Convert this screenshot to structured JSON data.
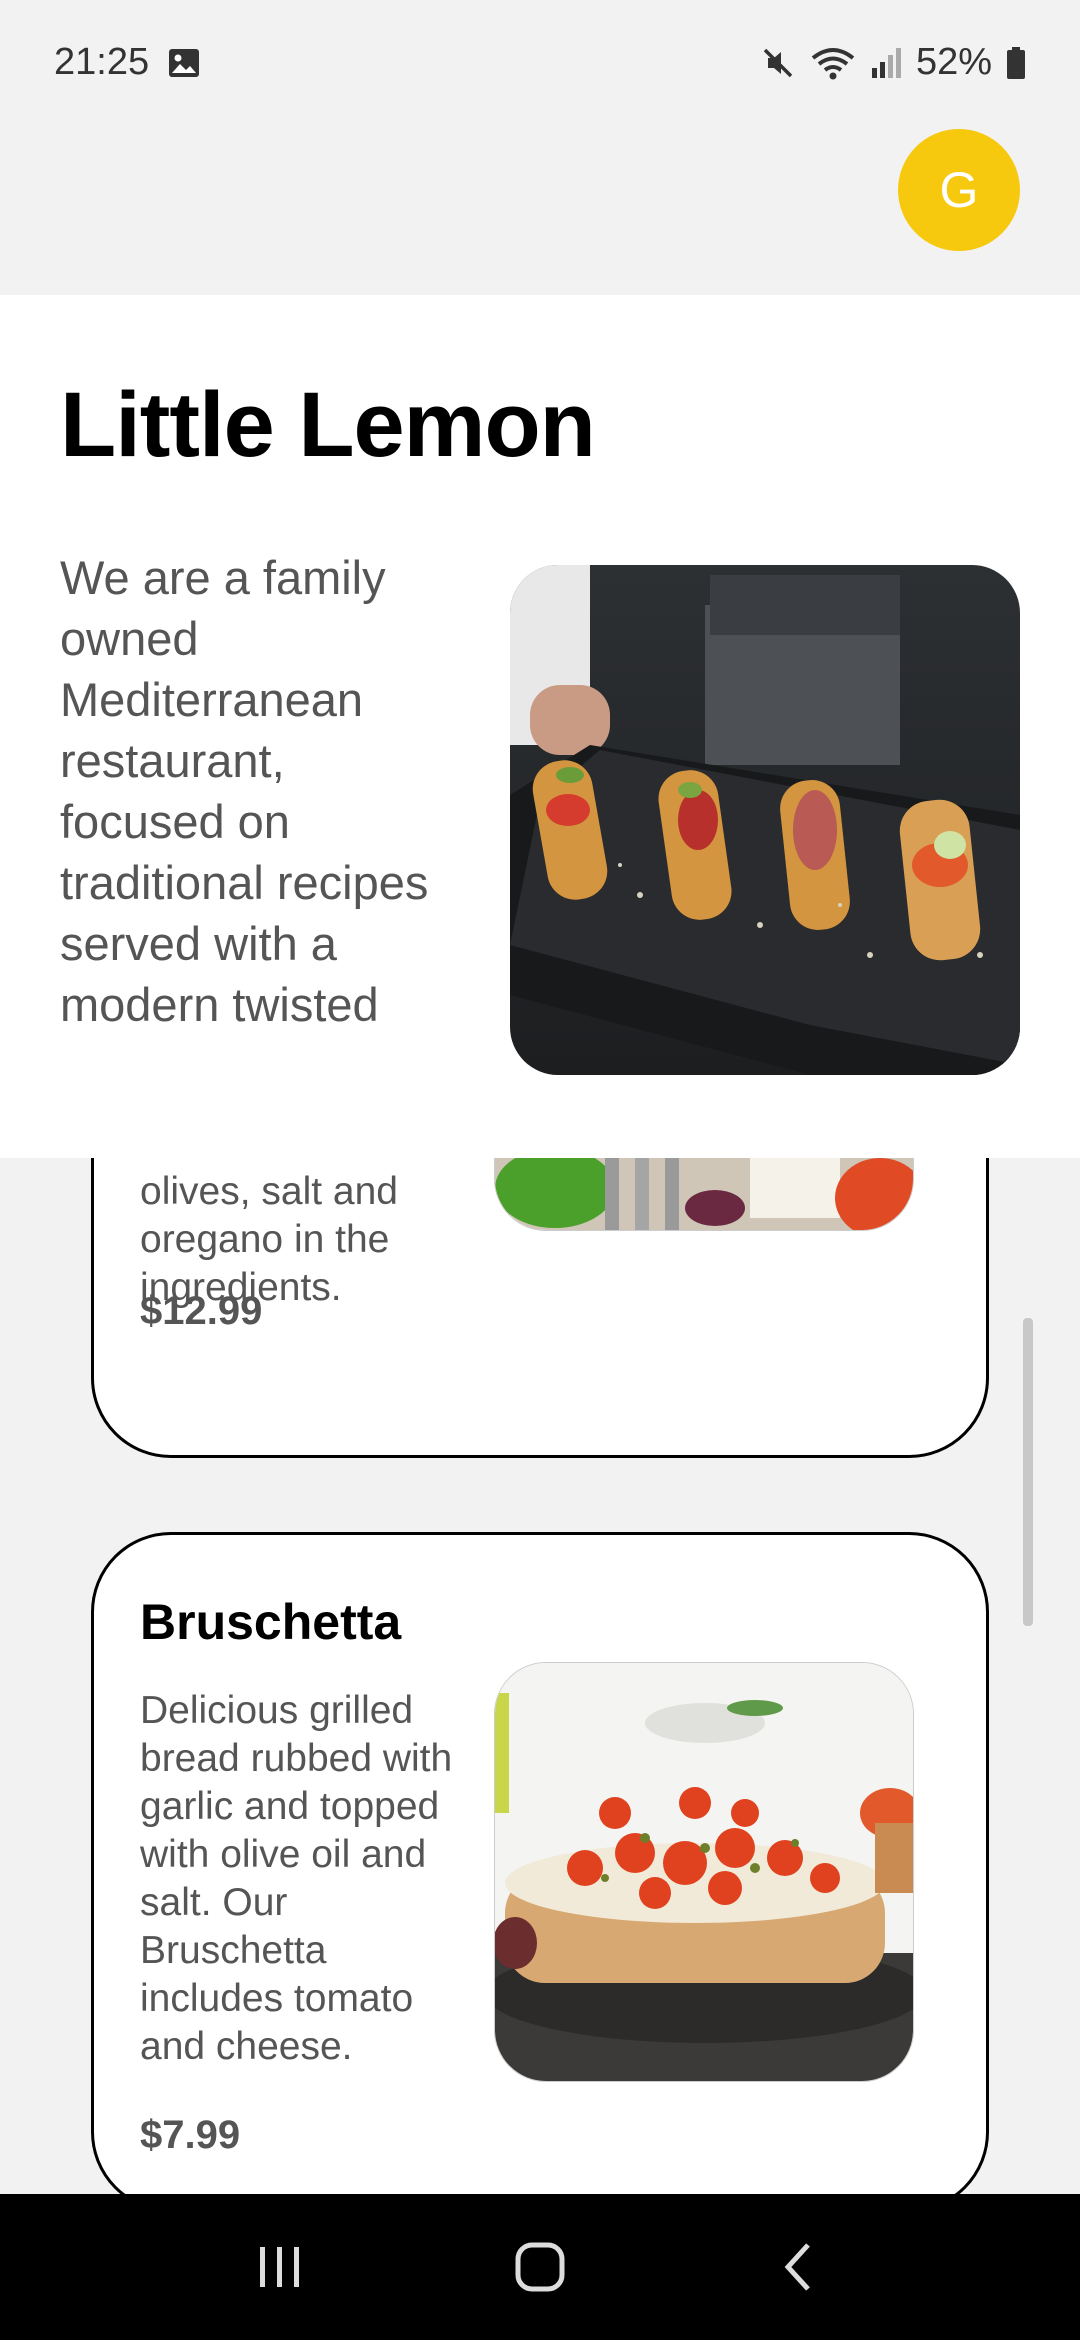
{
  "status_bar": {
    "time": "21:25",
    "battery": "52%",
    "icons": [
      "gallery-icon",
      "mute-icon",
      "wifi-icon",
      "signal-icon",
      "battery-icon"
    ]
  },
  "header": {
    "avatar_initial": "G",
    "avatar_color": "#f6c90e"
  },
  "hero": {
    "title": "Little Lemon",
    "description": "We are a family owned Mediterranean restaurant, focused on traditional recipes served with a modern twisted"
  },
  "menu": {
    "items": [
      {
        "description_partial": "olives, salt and oregano in the ingredients.",
        "price": "$12.99"
      },
      {
        "name": "Bruschetta",
        "description": "Delicious grilled bread rubbed with garlic and topped with olive oil and salt. Our Bruschetta includes tomato and cheese.",
        "price": "$7.99"
      }
    ]
  },
  "nav": {
    "icons": [
      "recents-icon",
      "home-icon",
      "back-icon"
    ]
  }
}
